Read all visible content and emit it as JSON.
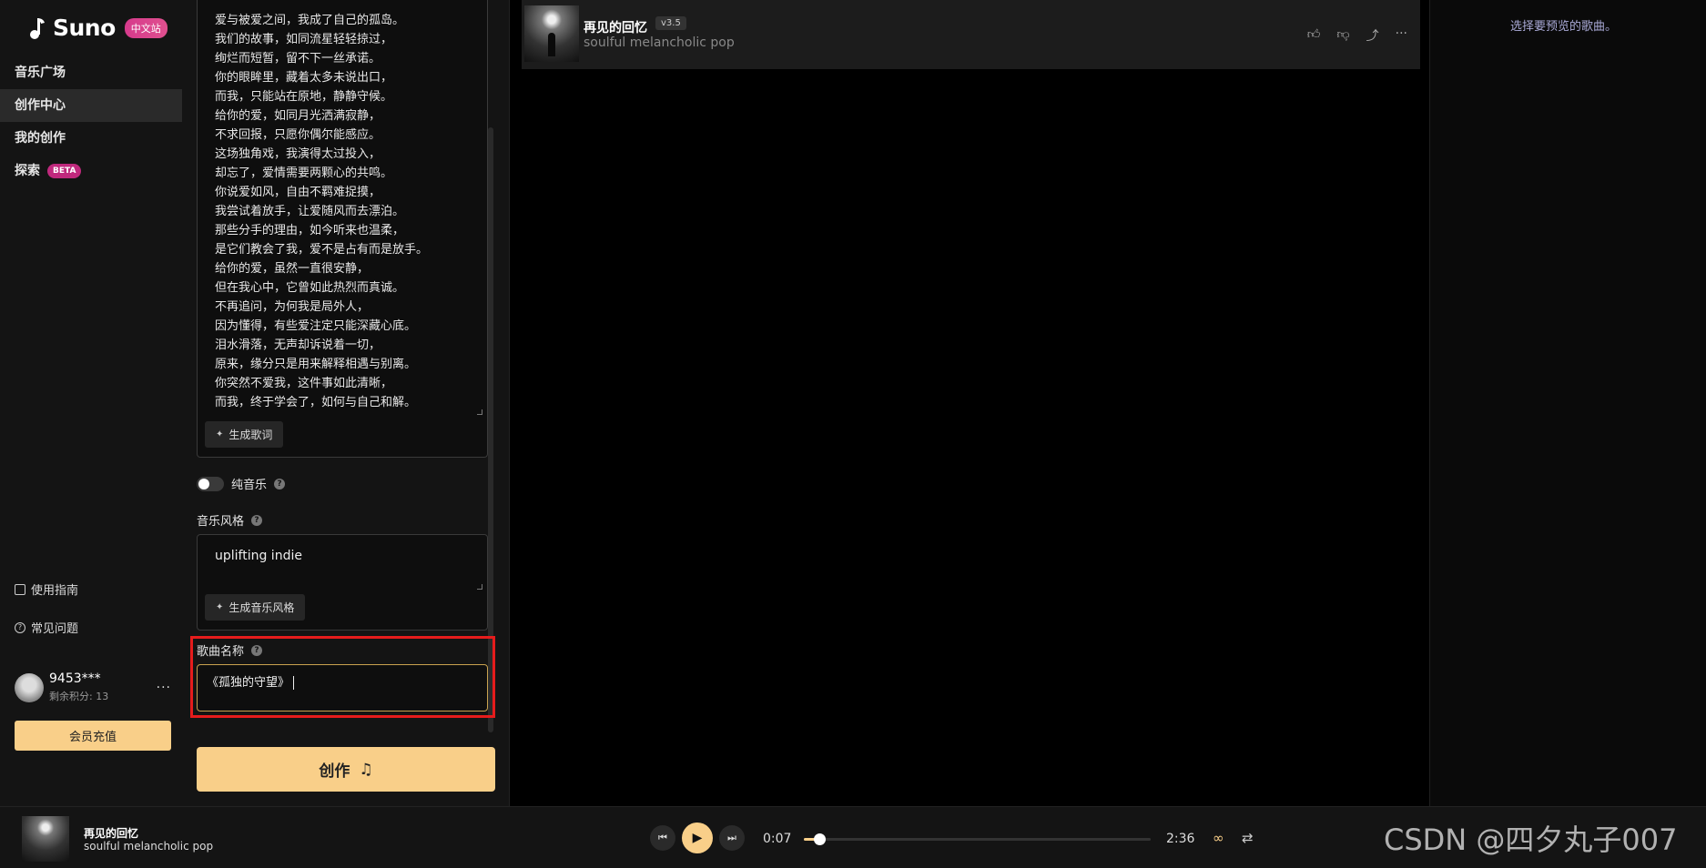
{
  "app": {
    "name": "Suno",
    "badge": "中文站"
  },
  "nav": [
    {
      "label": "音乐广场"
    },
    {
      "label": "创作中心",
      "active": true
    },
    {
      "label": "我的创作"
    },
    {
      "label": "探索",
      "badge": "BETA"
    }
  ],
  "side_links": {
    "guide": "使用指南",
    "faq": "常见问题"
  },
  "user": {
    "name": "9453***",
    "credits": "剩余积分: 13",
    "more": "···",
    "recharge": "会员充值"
  },
  "form": {
    "lyrics": [
      "爱与被爱之间，我成了自己的孤岛。",
      "我们的故事，如同流星轻轻掠过，",
      "绚烂而短暂，留不下一丝承诺。",
      "你的眼眸里，藏着太多未说出口，",
      "而我，只能站在原地，静静守候。",
      "给你的爱，如同月光洒满寂静，",
      "不求回报，只愿你偶尔能感应。",
      "这场独角戏，我演得太过投入，",
      "却忘了，爱情需要两颗心的共鸣。",
      "你说爱如风，自由不羁难捉摸，",
      "我尝试着放手，让爱随风而去漂泊。",
      "那些分手的理由，如今听来也温柔，",
      "是它们教会了我，爱不是占有而是放手。",
      "给你的爱，虽然一直很安静，",
      "但在我心中，它曾如此热烈而真诚。",
      "不再追问，为何我是局外人，",
      "因为懂得，有些爱注定只能深藏心底。",
      "泪水滑落，无声却诉说着一切，",
      "原来，缘分只是用来解释相遇与别离。",
      "你突然不爱我，这件事如此清晰，",
      "而我，终于学会了，如何与自己和解。"
    ],
    "gen_lyrics": "生成歌词",
    "instrumental": "纯音乐",
    "style_label": "音乐风格",
    "style_value": "uplifting indie",
    "gen_style": "生成音乐风格",
    "title_label": "歌曲名称",
    "title_value": "《孤独的守望》",
    "create": "创作"
  },
  "song_card": {
    "title": "再见的回忆",
    "version": "v3.5",
    "style": "soulful melancholic pop"
  },
  "preview": {
    "hint": "选择要预览的歌曲。"
  },
  "player": {
    "title": "再见的回忆",
    "style": "soulful melancholic pop",
    "current": "0:07",
    "duration": "2:36",
    "progress": 0.045
  },
  "watermark": "CSDN @四夕丸子007",
  "colors": {
    "accent": "#f9cf89",
    "highlight": "#e51c1c",
    "badge": "#d63a8c"
  }
}
